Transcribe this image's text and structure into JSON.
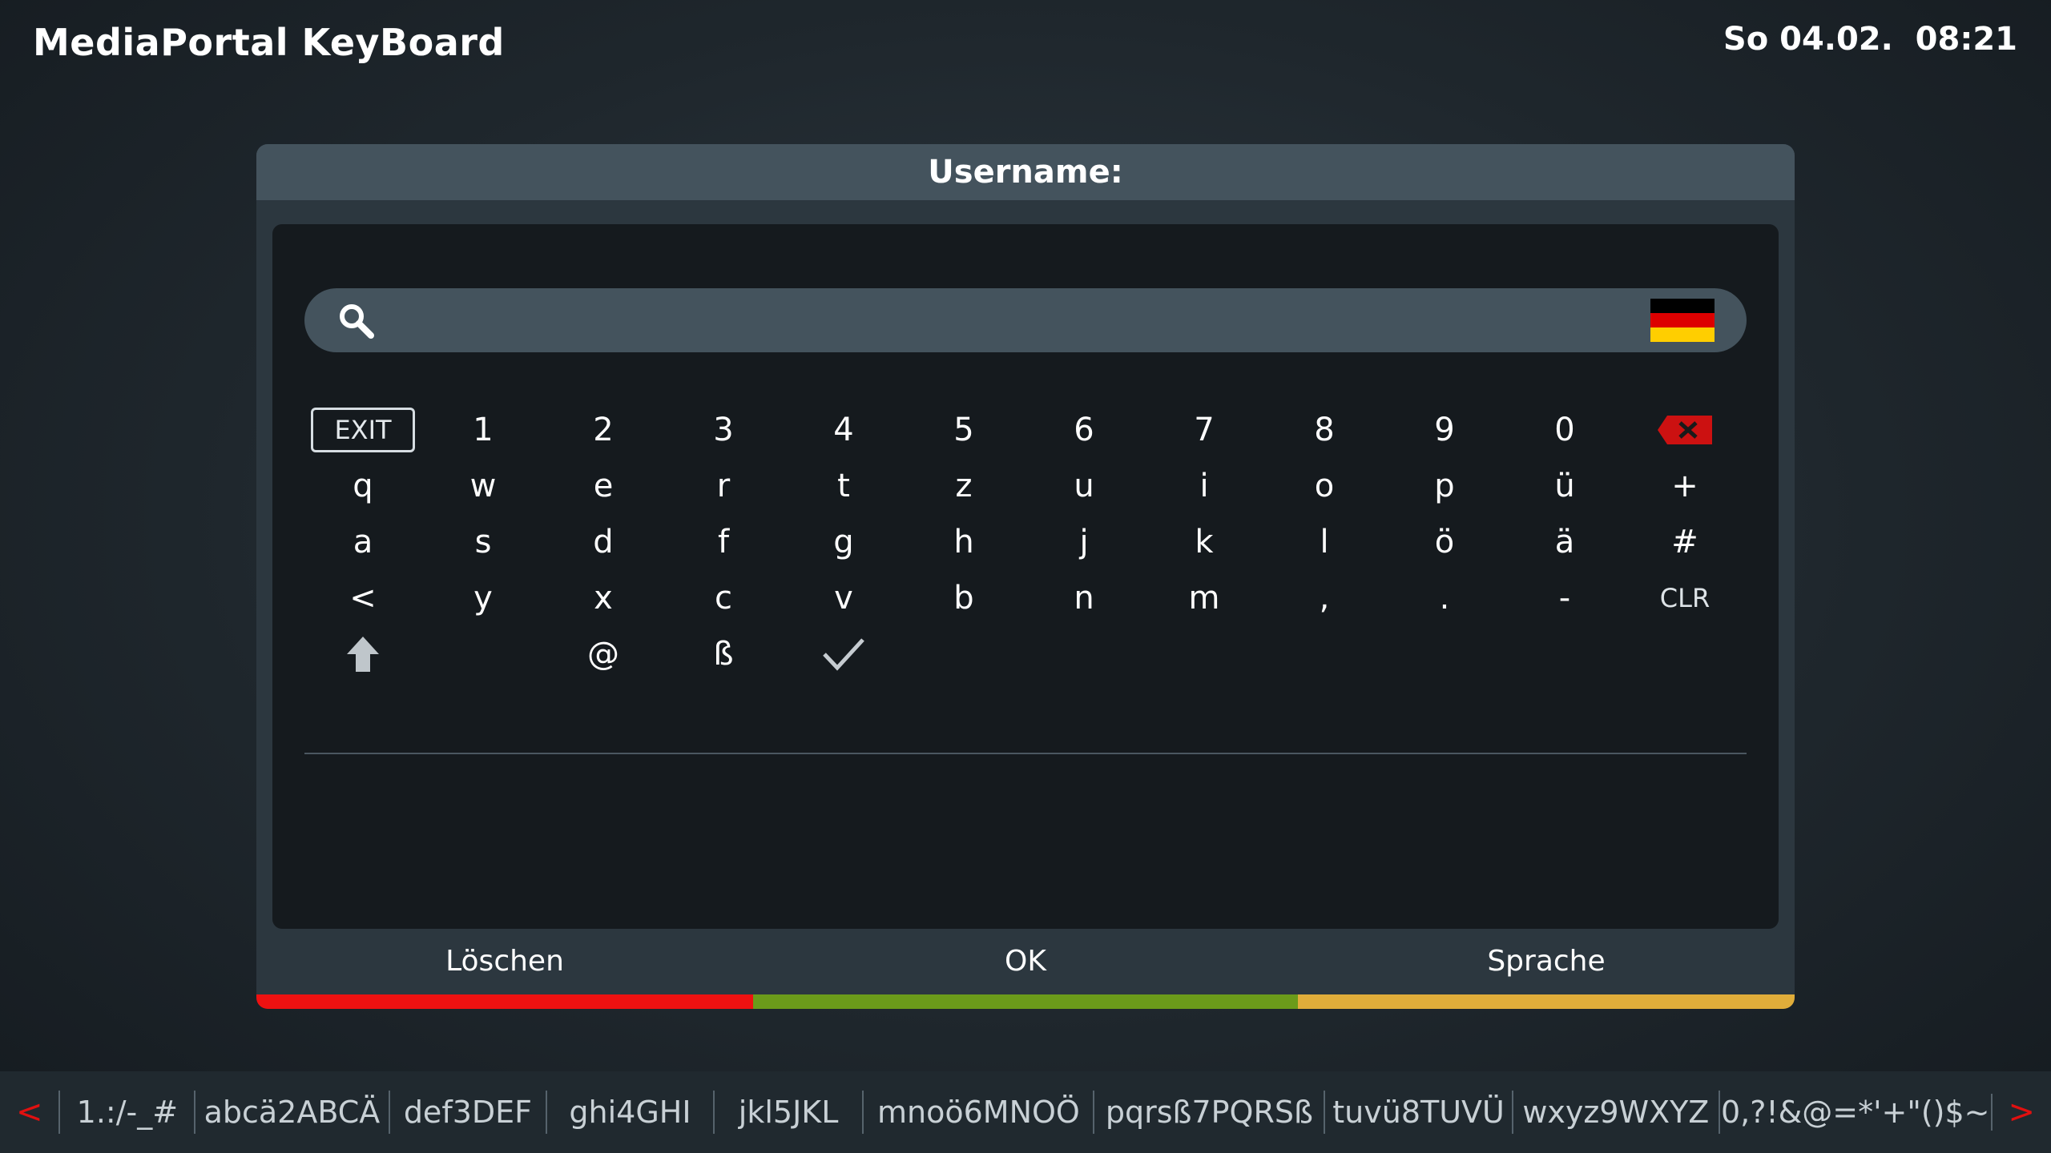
{
  "header": {
    "title": "MediaPortal KeyBoard",
    "datetime": "So 04.02.  08:21"
  },
  "dialog": {
    "title": "Username:",
    "input": {
      "value": "",
      "language": "German flag"
    },
    "keyboard": {
      "rows": [
        [
          "EXIT",
          "1",
          "2",
          "3",
          "4",
          "5",
          "6",
          "7",
          "8",
          "9",
          "0",
          "backspace"
        ],
        [
          "q",
          "w",
          "e",
          "r",
          "t",
          "z",
          "u",
          "i",
          "o",
          "p",
          "ü",
          "+"
        ],
        [
          "a",
          "s",
          "d",
          "f",
          "g",
          "h",
          "j",
          "k",
          "l",
          "ö",
          "ä",
          "#"
        ],
        [
          "<",
          "y",
          "x",
          "c",
          "v",
          "b",
          "n",
          "m",
          ",",
          ".",
          "-",
          "CLR"
        ],
        [
          "shift",
          "",
          "@",
          "ß",
          "check"
        ]
      ]
    },
    "buttons": {
      "delete_label": "Löschen",
      "ok_label": "OK",
      "language_label": "Sprache"
    },
    "colors": {
      "red": "#ee1111",
      "green": "#6b9b1a",
      "yellow": "#e0ad3a"
    }
  },
  "bottom_bar": {
    "prev": "<",
    "next": ">",
    "groups": [
      "1.:/-_#",
      "abcä2ABCÄ",
      "def3DEF",
      "ghi4GHI",
      "jkl5JKL",
      "mnoö6MNOÖ",
      "pqrsß7PQRSß",
      "tuvü8TUVÜ",
      "wxyz9WXYZ",
      "0,?!&@=*'+\"()$~"
    ]
  }
}
